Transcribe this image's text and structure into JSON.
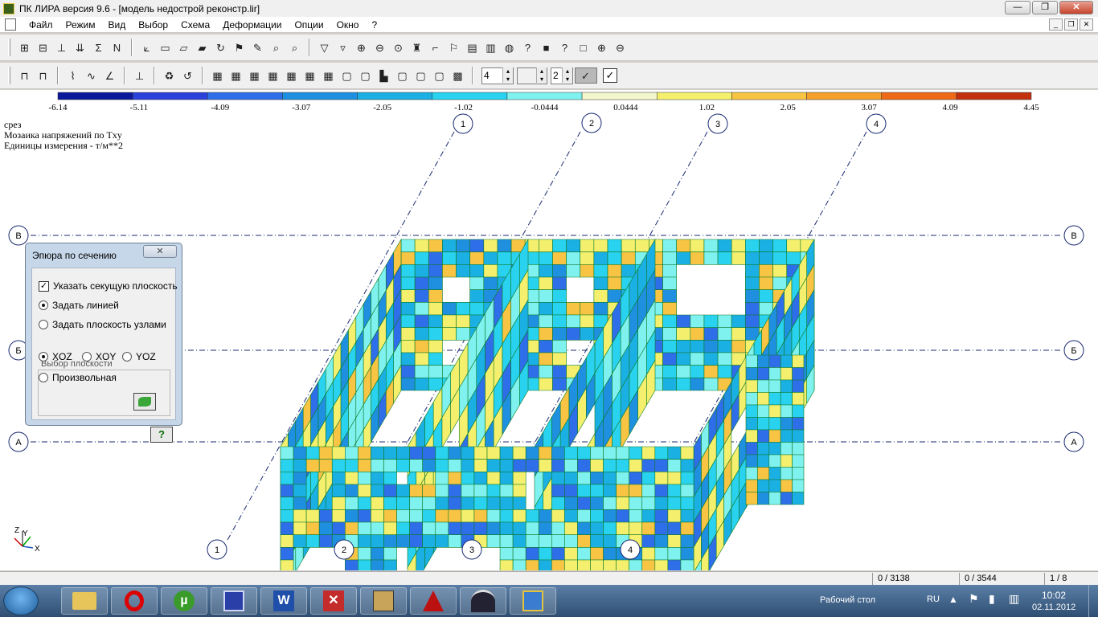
{
  "window": {
    "title": "ПК ЛИРА  версия 9.6 - [модель недострой реконстр.lir]",
    "controls": [
      "—",
      "❐",
      "✕"
    ]
  },
  "menu": [
    "Файл",
    "Режим",
    "Вид",
    "Выбор",
    "Схема",
    "Деформации",
    "Опции",
    "Окно",
    "?"
  ],
  "toolbar2": {
    "spin1_value": "4",
    "spin2_value": "2"
  },
  "legend": {
    "values": [
      "-6.14",
      "-5.11",
      "-4.09",
      "-3.07",
      "-2.05",
      "-1.02",
      "-0.0444",
      "0.0444",
      "1.02",
      "2.05",
      "3.07",
      "4.09",
      "4.45"
    ],
    "colors": [
      "#0a189a",
      "#2a42d9",
      "#2e6ee8",
      "#1f8fe0",
      "#1bb0e3",
      "#29d2ef",
      "#7ff2ef",
      "#f4f6cc",
      "#f4f06d",
      "#f7c443",
      "#f4a02a",
      "#ef6a17",
      "#c2300e"
    ]
  },
  "info": {
    "line1": "срез",
    "line2": "Мозаика напряжений по Txy",
    "line3": "Единицы измерения - т/м**2"
  },
  "axes": {
    "top_numbers": [
      "1",
      "2",
      "3",
      "4"
    ],
    "bottom_numbers": [
      "1",
      "2",
      "3",
      "4"
    ],
    "row_letters": [
      "В",
      "Б",
      "А"
    ],
    "triad": {
      "z": "Z",
      "y": "Y",
      "x": "X"
    }
  },
  "dialog": {
    "title": "Эпюра по сечению",
    "close": "✕",
    "checkbox_label": "Указать секущую плоскость",
    "radio_line": "Задать линией",
    "radio_nodes": "Задать плоскость узлами",
    "group_label": "Выбор плоскости",
    "xoz": "XOZ",
    "xoy": "XOY",
    "yoz": "YOZ",
    "arbitrary": "Произвольная",
    "help": "?"
  },
  "status": {
    "cell1": "0 / 3138",
    "cell2": "0 / 3544",
    "cell3": "1 / 8"
  },
  "taskbar": {
    "desktop_label": "Рабочий стол",
    "lang": "RU",
    "time": "10:02",
    "date": "02.11.2012",
    "apps": [
      "explorer-icon",
      "opera-icon",
      "utorrent-icon",
      "save-icon",
      "word-icon",
      "foxit-icon",
      "lira-grid-icon",
      "acrobat-icon",
      "arch-icon",
      "lira-icon"
    ]
  }
}
